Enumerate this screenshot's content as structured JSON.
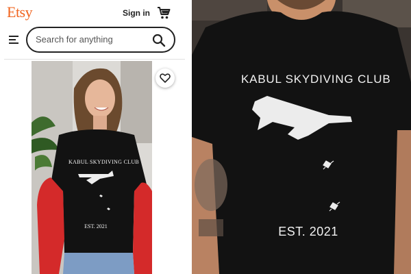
{
  "header": {
    "logo": "Etsy",
    "sign_in_label": "Sign in",
    "cart_icon": "cart-icon",
    "menu_icon": "hamburger-icon"
  },
  "search": {
    "placeholder": "Search for anything",
    "value": "",
    "icon": "search-icon"
  },
  "listing": {
    "favorite_icon": "heart-icon",
    "shirt_text": {
      "title": "KABUL SKYDIVING CLUB",
      "established": "EST. 2021"
    }
  },
  "closeup": {
    "shirt_text": {
      "title": "KABUL SKYDIVING CLUB",
      "established": "EST. 2021"
    }
  },
  "colors": {
    "brand": "#f1641e",
    "shirt": "#121212",
    "jacket": "#d42a2a"
  }
}
